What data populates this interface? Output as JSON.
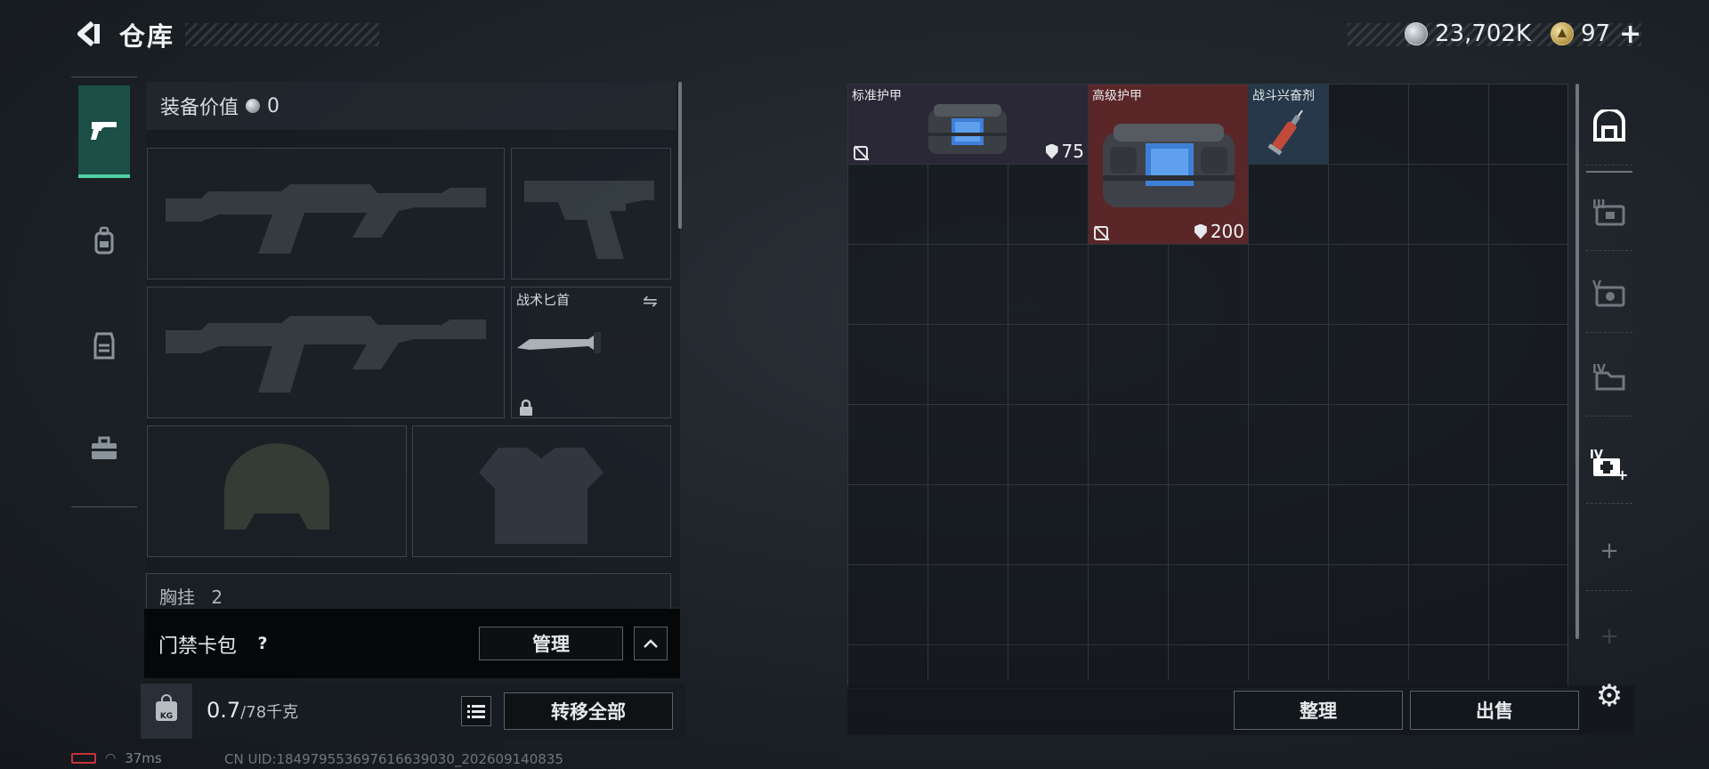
{
  "header": {
    "title": "仓库",
    "currency": {
      "silver": "23,702K",
      "gold": "97"
    }
  },
  "equipment": {
    "value_label": "装备价值",
    "value": "0",
    "knife_label": "战术匕首",
    "chest_label": "胸挂",
    "chest_count": "2"
  },
  "keycard": {
    "label": "门禁卡包",
    "help": "?",
    "manage_label": "管理"
  },
  "weight": {
    "current": "0.7",
    "max": "/78千克",
    "kg_badge": "KG"
  },
  "actions": {
    "transfer_all": "转移全部",
    "organize": "整理",
    "sell": "出售"
  },
  "warehouse": {
    "items": [
      {
        "name": "标准护甲",
        "armor": "75",
        "color": "#2a2836"
      },
      {
        "name": "高级护甲",
        "armor": "200",
        "color": "#5a2628"
      },
      {
        "name": "战斗兴奋剂",
        "armor": "",
        "color": "#26384a"
      }
    ]
  },
  "status": {
    "ping": "37ms",
    "uid": "CN UID:18497955369761663903​0_202609140835"
  },
  "icons": {
    "left_tabs": [
      "pistol-icon",
      "backpack-icon",
      "vest-icon",
      "toolbox-icon"
    ],
    "right_tabs": [
      "bag-icon",
      "tier3-case-icon",
      "tier5-case-icon",
      "tier4-case-icon",
      "medical-case-icon",
      "add-icon",
      "add-icon-disabled"
    ]
  }
}
